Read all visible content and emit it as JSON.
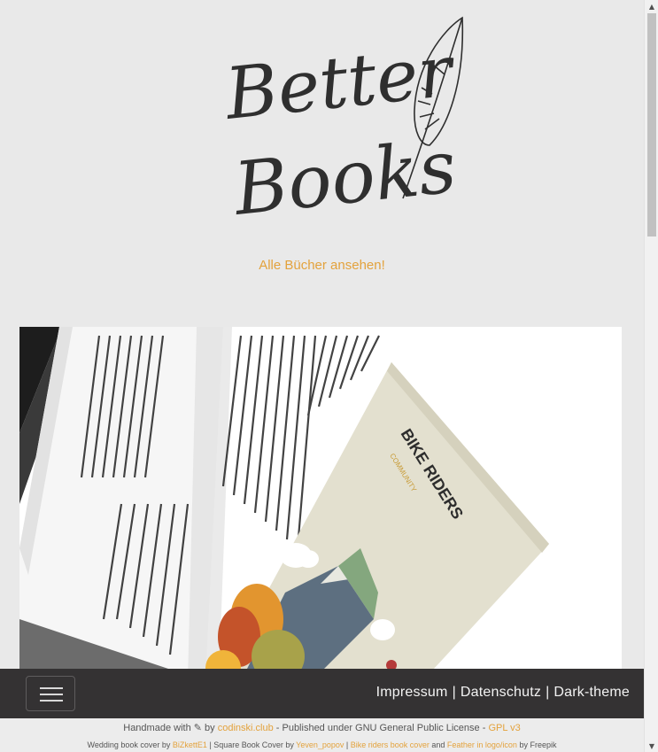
{
  "logo": {
    "line1": "Better",
    "line2": "Books",
    "icon": "feather-icon"
  },
  "browse_link": "Alle Bücher ansehen!",
  "hero": {
    "alt": "open book with Bike Riders cover",
    "cover_title_line1": "BIKE RIDERS",
    "cover_title_line2": "COMMUNITY"
  },
  "navbar": {
    "toggler_icon": "hamburger-icon",
    "links": [
      "Impressum",
      "Datenschutz",
      "Dark-theme"
    ],
    "separator": "|"
  },
  "footer": {
    "line1": {
      "prefix": "Handmade with",
      "icon": "magic-wand-icon",
      "by": "by",
      "author_link": "codinski.club",
      "middle": "- Published under GNU General Public License -",
      "license_link": "GPL v3"
    },
    "line2": {
      "t1": "Wedding book cover by",
      "l1": "BiZkettE1",
      "t2": "| Square Book Cover by",
      "l2": "Yeven_popov",
      "t3": "|",
      "l3": "Bike riders book cover",
      "t4": "and",
      "l4": "Feather in logo/icon",
      "t5": "by Freepik"
    }
  },
  "colors": {
    "accent": "#e3a23c",
    "navbar": "#343233",
    "background": "#e9e9e9"
  }
}
